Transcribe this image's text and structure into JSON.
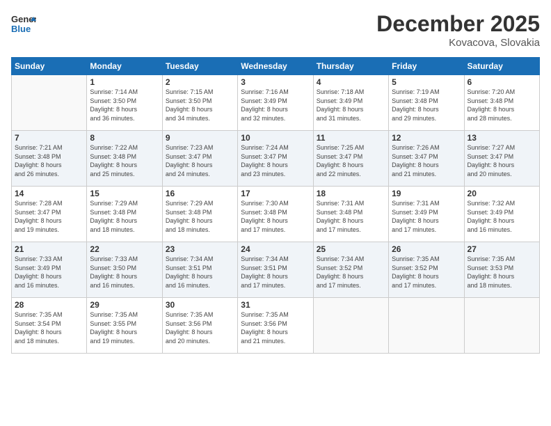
{
  "logo": {
    "line1": "General",
    "line2": "Blue"
  },
  "title": "December 2025",
  "location": "Kovacova, Slovakia",
  "header_days": [
    "Sunday",
    "Monday",
    "Tuesday",
    "Wednesday",
    "Thursday",
    "Friday",
    "Saturday"
  ],
  "weeks": [
    [
      {
        "day": "",
        "info": ""
      },
      {
        "day": "1",
        "info": "Sunrise: 7:14 AM\nSunset: 3:50 PM\nDaylight: 8 hours\nand 36 minutes."
      },
      {
        "day": "2",
        "info": "Sunrise: 7:15 AM\nSunset: 3:50 PM\nDaylight: 8 hours\nand 34 minutes."
      },
      {
        "day": "3",
        "info": "Sunrise: 7:16 AM\nSunset: 3:49 PM\nDaylight: 8 hours\nand 32 minutes."
      },
      {
        "day": "4",
        "info": "Sunrise: 7:18 AM\nSunset: 3:49 PM\nDaylight: 8 hours\nand 31 minutes."
      },
      {
        "day": "5",
        "info": "Sunrise: 7:19 AM\nSunset: 3:48 PM\nDaylight: 8 hours\nand 29 minutes."
      },
      {
        "day": "6",
        "info": "Sunrise: 7:20 AM\nSunset: 3:48 PM\nDaylight: 8 hours\nand 28 minutes."
      }
    ],
    [
      {
        "day": "7",
        "info": "Sunrise: 7:21 AM\nSunset: 3:48 PM\nDaylight: 8 hours\nand 26 minutes."
      },
      {
        "day": "8",
        "info": "Sunrise: 7:22 AM\nSunset: 3:48 PM\nDaylight: 8 hours\nand 25 minutes."
      },
      {
        "day": "9",
        "info": "Sunrise: 7:23 AM\nSunset: 3:47 PM\nDaylight: 8 hours\nand 24 minutes."
      },
      {
        "day": "10",
        "info": "Sunrise: 7:24 AM\nSunset: 3:47 PM\nDaylight: 8 hours\nand 23 minutes."
      },
      {
        "day": "11",
        "info": "Sunrise: 7:25 AM\nSunset: 3:47 PM\nDaylight: 8 hours\nand 22 minutes."
      },
      {
        "day": "12",
        "info": "Sunrise: 7:26 AM\nSunset: 3:47 PM\nDaylight: 8 hours\nand 21 minutes."
      },
      {
        "day": "13",
        "info": "Sunrise: 7:27 AM\nSunset: 3:47 PM\nDaylight: 8 hours\nand 20 minutes."
      }
    ],
    [
      {
        "day": "14",
        "info": "Sunrise: 7:28 AM\nSunset: 3:47 PM\nDaylight: 8 hours\nand 19 minutes."
      },
      {
        "day": "15",
        "info": "Sunrise: 7:29 AM\nSunset: 3:48 PM\nDaylight: 8 hours\nand 18 minutes."
      },
      {
        "day": "16",
        "info": "Sunrise: 7:29 AM\nSunset: 3:48 PM\nDaylight: 8 hours\nand 18 minutes."
      },
      {
        "day": "17",
        "info": "Sunrise: 7:30 AM\nSunset: 3:48 PM\nDaylight: 8 hours\nand 17 minutes."
      },
      {
        "day": "18",
        "info": "Sunrise: 7:31 AM\nSunset: 3:48 PM\nDaylight: 8 hours\nand 17 minutes."
      },
      {
        "day": "19",
        "info": "Sunrise: 7:31 AM\nSunset: 3:49 PM\nDaylight: 8 hours\nand 17 minutes."
      },
      {
        "day": "20",
        "info": "Sunrise: 7:32 AM\nSunset: 3:49 PM\nDaylight: 8 hours\nand 16 minutes."
      }
    ],
    [
      {
        "day": "21",
        "info": "Sunrise: 7:33 AM\nSunset: 3:49 PM\nDaylight: 8 hours\nand 16 minutes."
      },
      {
        "day": "22",
        "info": "Sunrise: 7:33 AM\nSunset: 3:50 PM\nDaylight: 8 hours\nand 16 minutes."
      },
      {
        "day": "23",
        "info": "Sunrise: 7:34 AM\nSunset: 3:51 PM\nDaylight: 8 hours\nand 16 minutes."
      },
      {
        "day": "24",
        "info": "Sunrise: 7:34 AM\nSunset: 3:51 PM\nDaylight: 8 hours\nand 17 minutes."
      },
      {
        "day": "25",
        "info": "Sunrise: 7:34 AM\nSunset: 3:52 PM\nDaylight: 8 hours\nand 17 minutes."
      },
      {
        "day": "26",
        "info": "Sunrise: 7:35 AM\nSunset: 3:52 PM\nDaylight: 8 hours\nand 17 minutes."
      },
      {
        "day": "27",
        "info": "Sunrise: 7:35 AM\nSunset: 3:53 PM\nDaylight: 8 hours\nand 18 minutes."
      }
    ],
    [
      {
        "day": "28",
        "info": "Sunrise: 7:35 AM\nSunset: 3:54 PM\nDaylight: 8 hours\nand 18 minutes."
      },
      {
        "day": "29",
        "info": "Sunrise: 7:35 AM\nSunset: 3:55 PM\nDaylight: 8 hours\nand 19 minutes."
      },
      {
        "day": "30",
        "info": "Sunrise: 7:35 AM\nSunset: 3:56 PM\nDaylight: 8 hours\nand 20 minutes."
      },
      {
        "day": "31",
        "info": "Sunrise: 7:35 AM\nSunset: 3:56 PM\nDaylight: 8 hours\nand 21 minutes."
      },
      {
        "day": "",
        "info": ""
      },
      {
        "day": "",
        "info": ""
      },
      {
        "day": "",
        "info": ""
      }
    ]
  ]
}
